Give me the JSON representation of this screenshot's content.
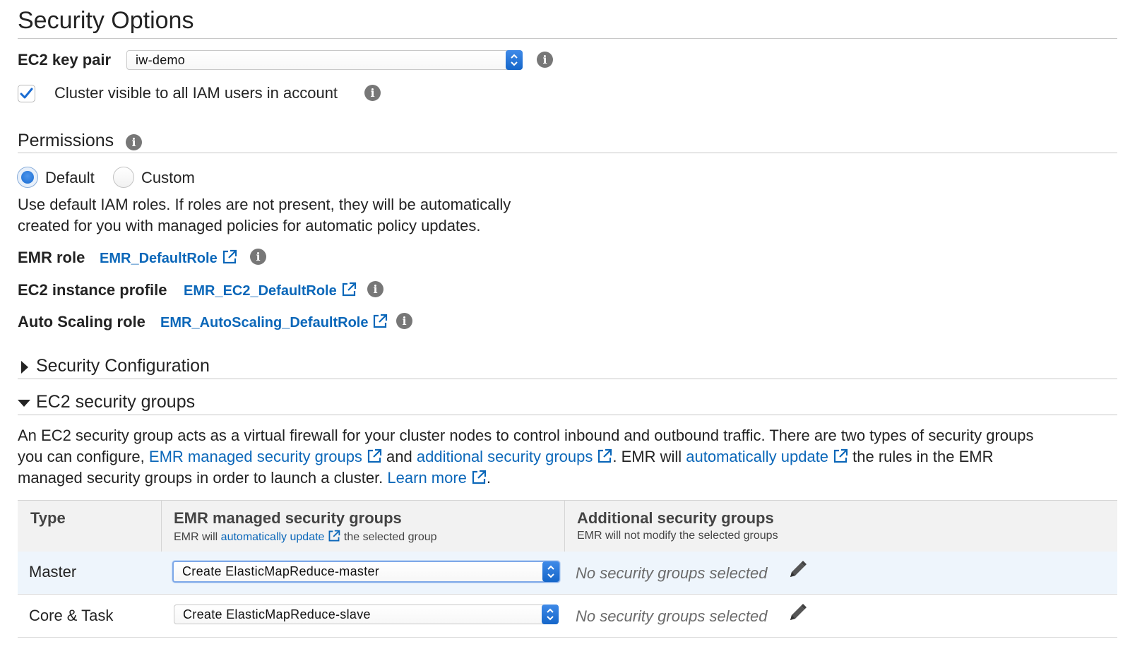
{
  "security_options": {
    "title": "Security Options",
    "key_pair_label": "EC2 key pair",
    "key_pair_value": "iw-demo",
    "cluster_visible_label": "Cluster visible to all IAM users in account",
    "cluster_visible_checked": true
  },
  "permissions": {
    "title": "Permissions",
    "options": [
      {
        "label": "Default",
        "selected": true
      },
      {
        "label": "Custom",
        "selected": false
      }
    ],
    "description_line1": "Use default IAM roles. If roles are not present, they will be automatically",
    "description_line2": "created for you with managed policies for automatic policy updates.",
    "roles": [
      {
        "label": "EMR role",
        "value": "EMR_DefaultRole"
      },
      {
        "label": "EC2 instance profile",
        "value": "EMR_EC2_DefaultRole"
      },
      {
        "label": "Auto Scaling role",
        "value": "EMR_AutoScaling_DefaultRole"
      }
    ]
  },
  "security_configuration": {
    "title": "Security Configuration",
    "expanded": false
  },
  "ec2_security_groups": {
    "title": "EC2 security groups",
    "expanded": true,
    "description": {
      "part1": "An EC2 security group acts as a virtual firewall for your cluster nodes to control inbound and outbound traffic. There are two types of security groups",
      "part2": "you can configure, ",
      "link1": "EMR managed security groups",
      "part3": " and ",
      "link2": "additional security groups",
      "part4": ". EMR will ",
      "link3": "automatically update",
      "part5": " the rules in the EMR",
      "part6": "managed security groups in order to launch a cluster. ",
      "link4": "Learn more",
      "part7": "."
    },
    "table": {
      "col_type": "Type",
      "col_managed_title": "EMR managed security groups",
      "col_managed_sub_pre": "EMR will ",
      "col_managed_sub_link": "automatically update",
      "col_managed_sub_post": " the selected group",
      "col_additional_title": "Additional security groups",
      "col_additional_sub": "EMR will not modify the selected groups",
      "rows": [
        {
          "type": "Master",
          "managed": "Create ElasticMapReduce-master",
          "additional": "No security groups selected"
        },
        {
          "type": "Core & Task",
          "managed": "Create ElasticMapReduce-slave",
          "additional": "No security groups selected"
        }
      ]
    }
  },
  "colors": {
    "link": "#0b67b9",
    "accent": "#1a6cd2",
    "selected_row": "#eef5fc"
  }
}
